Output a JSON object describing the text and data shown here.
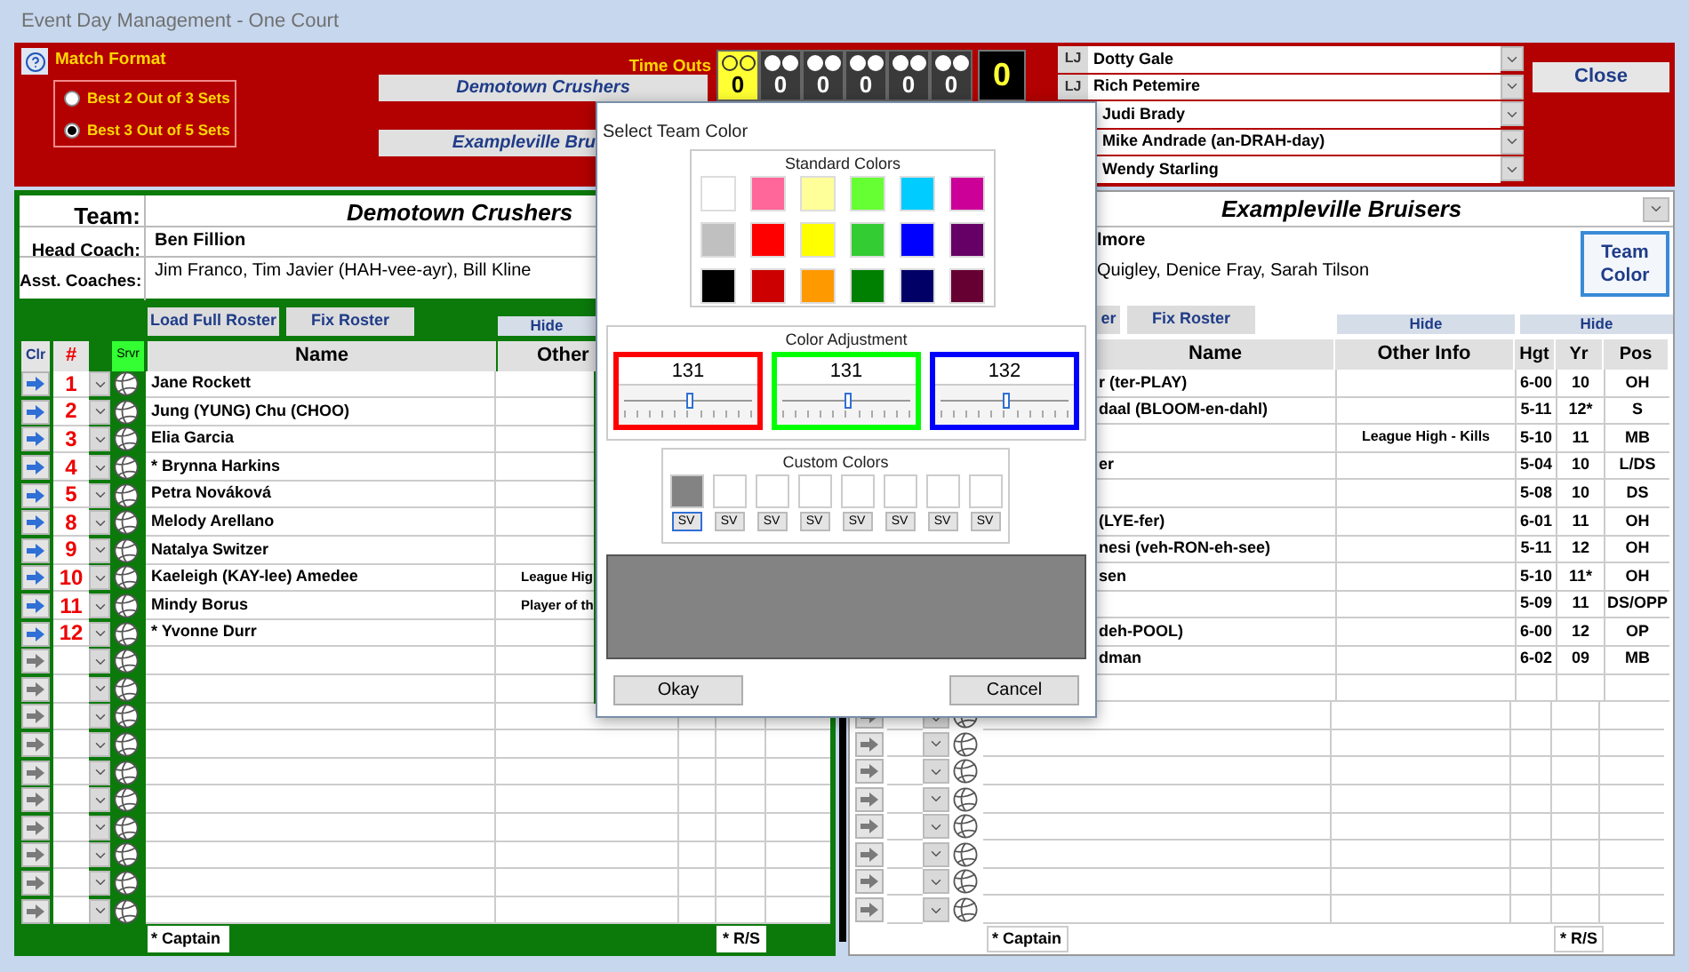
{
  "window": {
    "title": "Event Day Management - One Court"
  },
  "match_format": {
    "label": "Match Format",
    "options": [
      {
        "label": "Best 2 Out of 3 Sets",
        "selected": false
      },
      {
        "label": "Best 3 Out of 5 Sets",
        "selected": true
      }
    ]
  },
  "team_buttons": [
    "Demotown Crushers",
    "Exampleville Bru"
  ],
  "timeouts": {
    "label": "Time Outs",
    "score": "0",
    "boxes": [
      {
        "count": "0",
        "highlighted": true,
        "circles": [
          {
            "filled": false
          },
          {
            "filled": false
          }
        ]
      },
      {
        "count": "0",
        "highlighted": false,
        "circles": [
          {
            "filled": true
          },
          {
            "filled": true
          }
        ]
      },
      {
        "count": "0",
        "highlighted": false,
        "circles": [
          {
            "filled": true
          },
          {
            "filled": true
          }
        ]
      },
      {
        "count": "0",
        "highlighted": false,
        "circles": [
          {
            "filled": true
          },
          {
            "filled": true
          }
        ]
      },
      {
        "count": "0",
        "highlighted": false,
        "circles": [
          {
            "filled": true
          },
          {
            "filled": true
          }
        ]
      },
      {
        "count": "0",
        "highlighted": false,
        "circles": [
          {
            "filled": true
          },
          {
            "filled": true
          }
        ]
      }
    ]
  },
  "line_judges": [
    {
      "label": "LJ",
      "name": "Dotty Gale"
    },
    {
      "label": "LJ",
      "name": "Rich Petemire"
    },
    {
      "name": "Judi Brady"
    },
    {
      "name": "Mike Andrade (an-DRAH-day)"
    },
    {
      "name": "Wendy Starling"
    }
  ],
  "close_button": "Close",
  "home": {
    "team_label": "Team:",
    "team": "Demotown Crushers",
    "head_coach_label": "Head Coach:",
    "head_coach": "Ben Fillion",
    "asst_label": "Asst. Coaches:",
    "asst": "Jim Franco, Tim Javier (HAH-vee-ayr), Bill Kline",
    "buttons": [
      "Load Full Roster",
      "Fix Roster"
    ],
    "hide_button": "Hide",
    "columns": [
      "Clr",
      "#",
      "Srvr",
      "Name",
      "Other"
    ],
    "rows": [
      {
        "kind": "player",
        "number": "1",
        "name": "Jane Rockett"
      },
      {
        "kind": "player",
        "number": "2",
        "name": "Jung (YUNG) Chu (CHOO)"
      },
      {
        "kind": "player",
        "number": "3",
        "name": "Elia Garcia"
      },
      {
        "kind": "player",
        "number": "4",
        "name": "* Brynna Harkins"
      },
      {
        "kind": "player",
        "number": "5",
        "name": "Petra Nováková"
      },
      {
        "kind": "player",
        "number": "8",
        "name": "Melody Arellano"
      },
      {
        "kind": "player",
        "number": "9",
        "name": "Natalya Switzer"
      },
      {
        "kind": "player",
        "number": "10",
        "name": "Kaeleigh (KAY-lee) Amedee",
        "other": "League Hig"
      },
      {
        "kind": "player",
        "number": "11",
        "name": "Mindy Borus",
        "other": "Player of th"
      },
      {
        "kind": "player",
        "number": "12",
        "name": "* Yvonne Durr"
      },
      {
        "kind": "empty"
      },
      {
        "kind": "empty"
      },
      {
        "kind": "empty"
      },
      {
        "kind": "empty"
      },
      {
        "kind": "empty"
      },
      {
        "kind": "empty"
      },
      {
        "kind": "empty"
      },
      {
        "kind": "empty"
      },
      {
        "kind": "empty"
      },
      {
        "kind": "empty"
      }
    ],
    "footer": [
      "* Captain",
      "* R/S"
    ]
  },
  "away": {
    "team": "Exampleville Bruisers",
    "head_coach": "lmore",
    "asst": "Quigley, Denice Fray, Sarah Tilson",
    "team_color_button": "Team Color",
    "buttons": [
      "er",
      "Fix Roster"
    ],
    "hide_buttons": [
      "Hide",
      "Hide"
    ],
    "columns": [
      "Name",
      "Other Info",
      "Hgt",
      "Yr",
      "Pos"
    ],
    "rows": [
      {
        "name": "r (ter-PLAY)",
        "hgt": "6-00",
        "yr": "10",
        "pos": "OH"
      },
      {
        "name": "daal (BLOOM-en-dahl)",
        "hgt": "5-11",
        "yr": "12*",
        "pos": "S"
      },
      {
        "other": "League High - Kills",
        "hgt": "5-10",
        "yr": "11",
        "pos": "MB"
      },
      {
        "name": "er",
        "hgt": "5-04",
        "yr": "10",
        "pos": "L/DS"
      },
      {
        "hgt": "5-08",
        "yr": "10",
        "pos": "DS"
      },
      {
        "name": "(LYE-fer)",
        "hgt": "6-01",
        "yr": "11",
        "pos": "OH"
      },
      {
        "name": "nesi (veh-RON-eh-see)",
        "hgt": "5-11",
        "yr": "12",
        "pos": "OH"
      },
      {
        "name": "sen",
        "hgt": "5-10",
        "yr": "11*",
        "pos": "OH"
      },
      {
        "hgt": "5-09",
        "yr": "11",
        "pos": "DS/OPP"
      },
      {
        "name": "deh-POOL)",
        "hgt": "6-00",
        "yr": "12",
        "pos": "OP"
      },
      {
        "name": "dman",
        "hgt": "6-02",
        "yr": "09",
        "pos": "MB"
      }
    ],
    "empty_rows": [
      {
        "kind": "empty"
      },
      {
        "kind": "empty"
      },
      {
        "kind": "empty"
      },
      {
        "kind": "empty"
      },
      {
        "kind": "empty"
      },
      {
        "kind": "empty"
      },
      {
        "kind": "empty"
      },
      {
        "kind": "empty"
      }
    ],
    "footer": [
      "* Captain",
      "* R/S"
    ]
  },
  "dialog": {
    "title": "Select Team Color",
    "standard_label": "Standard Colors",
    "standard_colors": [
      {
        "color": "#ffffff"
      },
      {
        "color": "#ff6699"
      },
      {
        "color": "#ffff99"
      },
      {
        "color": "#66ff33"
      },
      {
        "color": "#00ccff"
      },
      {
        "color": "#cc0099"
      },
      {
        "color": "#c0c0c0"
      },
      {
        "color": "#ff0000"
      },
      {
        "color": "#ffff00"
      },
      {
        "color": "#33cc33"
      },
      {
        "color": "#0000ff"
      },
      {
        "color": "#660066"
      },
      {
        "color": "#000000"
      },
      {
        "color": "#cc0000"
      },
      {
        "color": "#ff9900"
      },
      {
        "color": "#008000"
      },
      {
        "color": "#000066"
      },
      {
        "color": "#660033"
      }
    ],
    "adjust_label": "Color Adjustment",
    "sliders": [
      {
        "value": "131",
        "level": 0.514,
        "color": "#ff0000"
      },
      {
        "value": "131",
        "level": 0.514,
        "color": "#00ff00"
      },
      {
        "value": "132",
        "level": 0.518,
        "color": "#0000ff"
      }
    ],
    "custom_label": "Custom Colors",
    "custom_colors": [
      {
        "color": "#838383",
        "button": "SV",
        "selected": true
      },
      {
        "color": "#ffffff",
        "button": "SV",
        "selected": false
      },
      {
        "color": "#ffffff",
        "button": "SV",
        "selected": false
      },
      {
        "color": "#ffffff",
        "button": "SV",
        "selected": false
      },
      {
        "color": "#ffffff",
        "button": "SV",
        "selected": false
      },
      {
        "color": "#ffffff",
        "button": "SV",
        "selected": false
      },
      {
        "color": "#ffffff",
        "button": "SV",
        "selected": false
      },
      {
        "color": "#ffffff",
        "button": "SV",
        "selected": false
      }
    ],
    "preview": {
      "color": "#838384"
    },
    "buttons": [
      "Okay",
      "Cancel"
    ]
  }
}
